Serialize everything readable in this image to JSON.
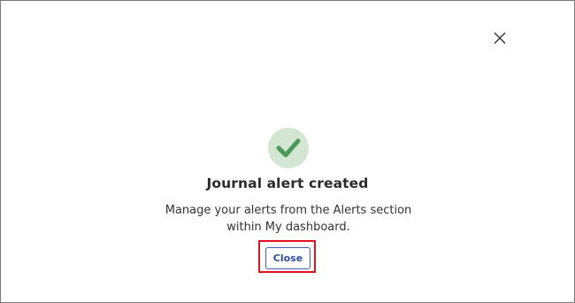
{
  "dialog": {
    "close_icon": "close-icon",
    "status_icon": "checkmark-icon",
    "title": "Journal alert created",
    "message": "Manage your alerts from the Alerts section within My dashboard.",
    "close_button_label": "Close"
  },
  "colors": {
    "accent": "#3f5fa8",
    "success": "#4a9a5a",
    "success_bg": "#d3e6d3",
    "highlight": "#e0141e"
  }
}
